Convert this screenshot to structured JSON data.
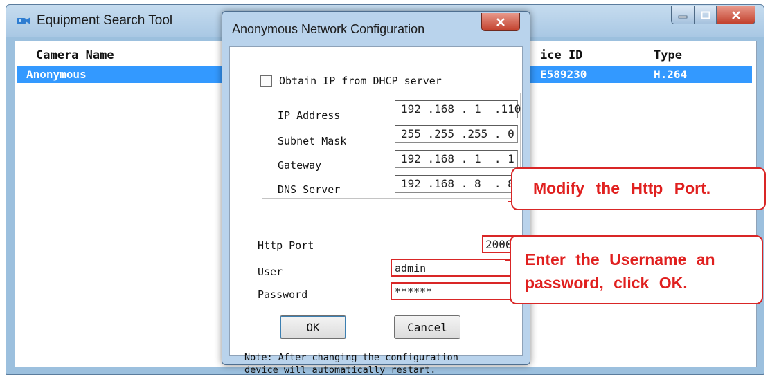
{
  "background_window": {
    "title": "Equipment Search Tool",
    "columns": {
      "camera_name": "Camera Name",
      "device_id": "ice ID",
      "type": "Type"
    },
    "rows": [
      {
        "camera_name": "Anonymous",
        "device_id": "E589230",
        "type": "H.264"
      }
    ]
  },
  "dialog": {
    "title": "Anonymous Network Configuration",
    "dhcp_label": "Obtain IP from DHCP server",
    "dhcp_checked": false,
    "fields": {
      "ip_address": {
        "label": "IP Address",
        "value": "192 .168 . 1  .110"
      },
      "subnet_mask": {
        "label": "Subnet Mask",
        "value": "255 .255 .255 . 0"
      },
      "gateway": {
        "label": "Gateway",
        "value": "192 .168 . 1  . 1"
      },
      "dns_server": {
        "label": "DNS Server",
        "value": "192 .168 . 8  . 8"
      }
    },
    "http_port": {
      "label": "Http Port",
      "value": "2000"
    },
    "user": {
      "label": "User",
      "value": "admin"
    },
    "password": {
      "label": "Password",
      "value": "******"
    },
    "ok_label": "OK",
    "cancel_label": "Cancel",
    "note_line1": "Note: After changing the configuration",
    "note_line2": "device will automatically restart."
  },
  "callouts": {
    "port": "Modify the Http Port.",
    "credentials_line1": "Enter the Username an",
    "credentials_line2": "password, click OK."
  },
  "colors": {
    "selection": "#3399ff",
    "annotation_red": "#d92626",
    "window_frame": "#9cc0de"
  }
}
